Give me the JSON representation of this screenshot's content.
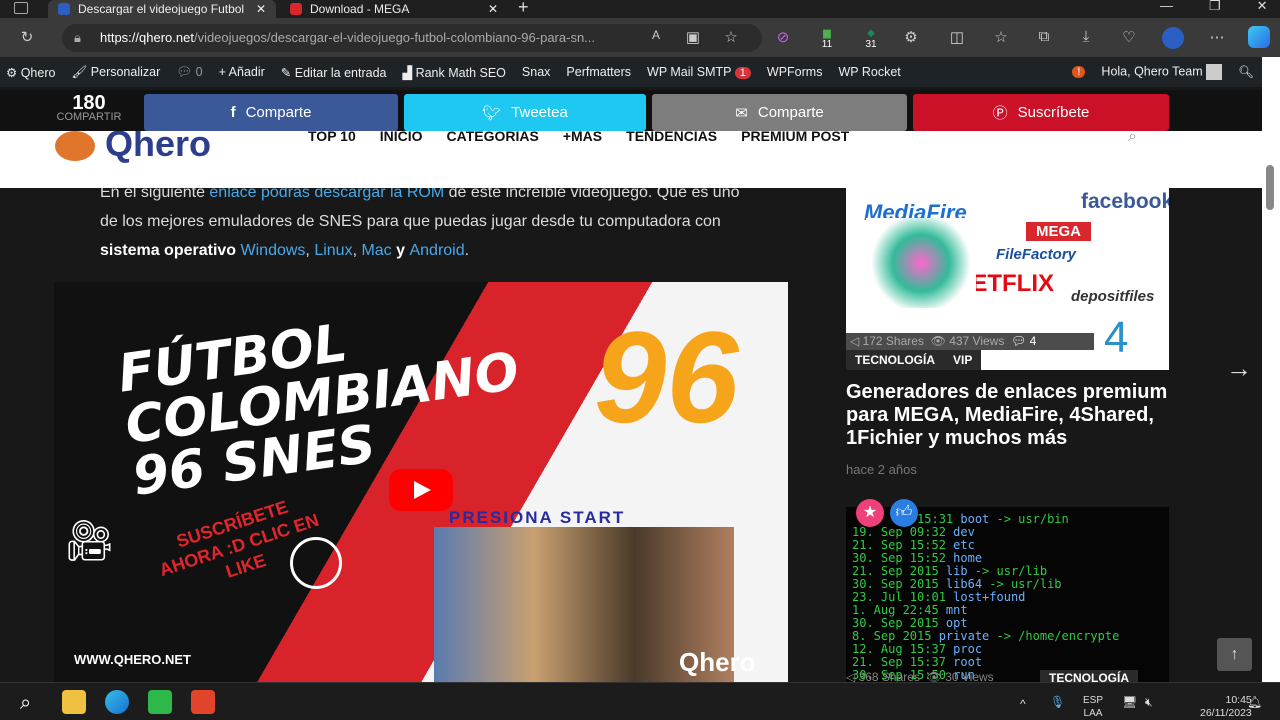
{
  "browser": {
    "tabs": [
      {
        "title": "Descargar el videojuego Futbol C",
        "active": true
      },
      {
        "title": "Download - MEGA",
        "active": false
      }
    ],
    "url_domain": "https://qhero.net",
    "url_path": "/videojuegos/descargar-el-videojuego-futbol-colombiano-96-para-sn...",
    "ext_badges": [
      "11",
      "31"
    ]
  },
  "wpbar": {
    "site": "Qhero",
    "customize": "Personalizar",
    "comments": "0",
    "add": "Añadir",
    "edit": "Editar la entrada",
    "rankmath": "Rank Math SEO",
    "snax": "Snax",
    "perfmatters": "Perfmatters",
    "smtp": "WP Mail SMTP",
    "smtp_badge": "1",
    "wpforms": "WPForms",
    "rocket": "WP Rocket",
    "greeting": "Hola, Qhero Team"
  },
  "share": {
    "count": "180",
    "count_label": "COMPARTIR",
    "buttons": [
      {
        "label": "Comparte",
        "color": "#3b5998"
      },
      {
        "label": "Tweetea",
        "color": "#1da1f2"
      },
      {
        "label": "Comparte",
        "color": "#7d7d7d"
      },
      {
        "label": "Suscríbete",
        "color": "#cb2027"
      }
    ]
  },
  "header": {
    "logo": "Qhero",
    "nav": [
      "TOP 10",
      "INICIO",
      "CATEGORÍAS",
      "+MÁS",
      "TENDENCIAS",
      "PREMIUM POST"
    ]
  },
  "article": {
    "p1_a": "En el siguiente ",
    "p1_link": "enlace podrás descargar la ROM",
    "p1_b": " de este increíble videojuego. Que es uno de los mejores emuladores de SNES para que puedas jugar desde tu computadora con ",
    "p1_bold": "sistema operativo",
    "links": [
      "Windows",
      "Linux",
      "Mac",
      "Android"
    ],
    "sep1": ", ",
    "y": " y ",
    "end": "."
  },
  "video": {
    "title": "FÚTBOL COLOMBIANO 96 SNES",
    "number": "96",
    "start": "PRESIONA START",
    "cta": "SUSCRÍBETE AHORA :D CLIC EN LIKE",
    "site": "WWW.QHERO.NET",
    "brand": "Qhero"
  },
  "sidebar": {
    "post1": {
      "shares": "172 Shares",
      "views": "437 Views",
      "comments": "4",
      "cats": [
        "TECNOLOGÍA",
        "VIP"
      ],
      "title": "Generadores de enlaces premium para MEGA, MediaFire, 4Shared, 1Fichier y muchos más",
      "date": "hace 2 años",
      "brands": [
        "MediaFire",
        "facebook",
        "MEGA",
        "FileFactory",
        "NETFLIX",
        "depositfiles",
        "4"
      ]
    },
    "post2": {
      "shares": "368 Shares",
      "views": "30 Views",
      "cat": "TECNOLOGÍA"
    }
  },
  "taskbar": {
    "lang1": "ESP",
    "lang2": "LAA",
    "time": "10:45",
    "date": "26/11/2023"
  }
}
